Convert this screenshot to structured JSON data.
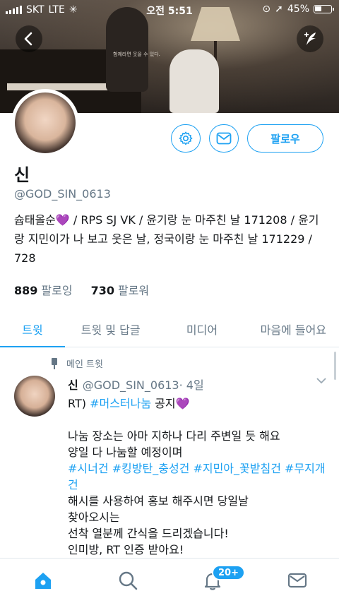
{
  "status_bar": {
    "carrier": "SKT",
    "network": "LTE",
    "time": "오전 5:51",
    "battery_percent": "45%",
    "battery_level": 0.45
  },
  "profile": {
    "display_name": "신",
    "handle": "@GOD_SIN_0613",
    "bio": "슙태올순💜 / RPS SJ VK / 윤기랑 눈 마주친 날 171208 / 윤기랑 지민이가 나 보고 웃은 날, 정국이랑 눈 마주친 날 171229 / 728",
    "following_count": "889",
    "following_label": "팔로잉",
    "followers_count": "730",
    "followers_label": "팔로워",
    "follow_button": "팔로우",
    "banner_caption": "함께라면 웃을 수 있다."
  },
  "tabs": [
    {
      "label": "트윗",
      "active": true
    },
    {
      "label": "트윗 및 답글",
      "active": false
    },
    {
      "label": "미디어",
      "active": false
    },
    {
      "label": "마음에 들어요",
      "active": false
    }
  ],
  "tweet": {
    "pinned_label": "메인 트윗",
    "name": "신",
    "handle": "@GOD_SIN_0613",
    "age": "· 4일",
    "line1_prefix": "RT) ",
    "line1_hashtag": "#머스터나눔",
    "line1_suffix": " 공지💜",
    "line2": "나눔 장소는 아마 지하나 다리 주변일 듯 해요",
    "line3": "양일 다 나눔할 예정이며",
    "hashtags": "#시너건 #킹방탄_충성건 #지민아_꽃받침건 #무지개건",
    "line4": "해시를 사용하여 홍보 해주시면 당일날",
    "line5": "찾아오시는",
    "line6": "선착 열분께 간식을 드리겠습니다!",
    "line7": "인미방, RT 인증 받아요!"
  },
  "bottom_nav": {
    "notification_badge": "20+"
  },
  "colors": {
    "accent": "#1da1f2",
    "muted": "#657786",
    "text": "#14171a"
  }
}
